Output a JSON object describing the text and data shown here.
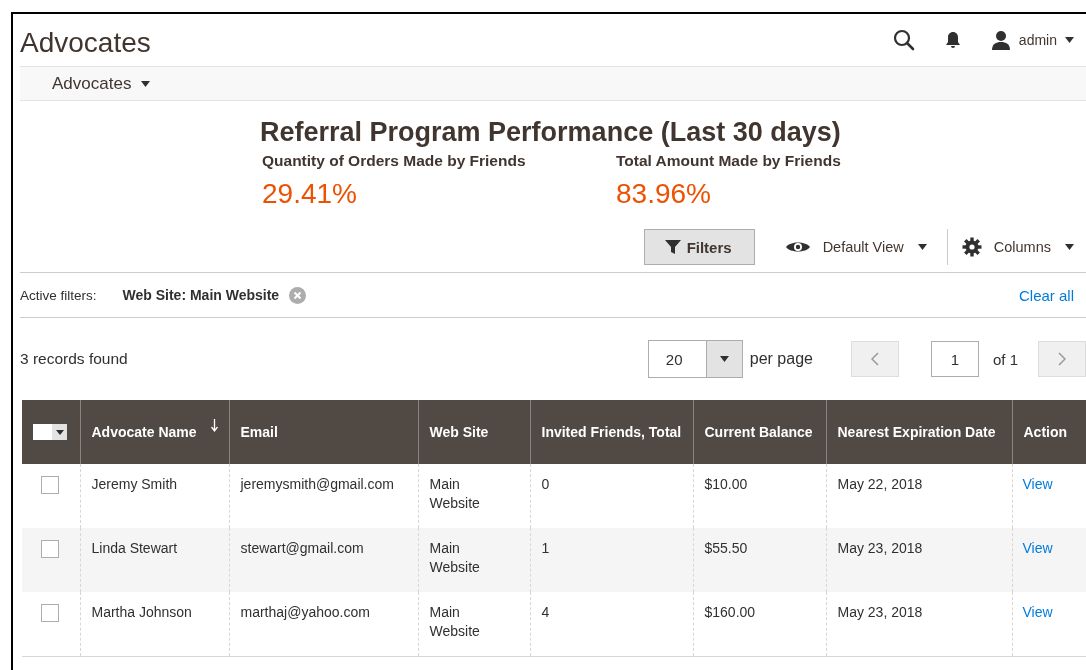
{
  "page": {
    "title": "Advocates",
    "user": "admin"
  },
  "nav": {
    "menu": "Advocates"
  },
  "performance": {
    "title": "Referral Program Performance (Last 30 days)",
    "stats": [
      {
        "label": "Quantity of Orders Made by Friends",
        "value": "29.41%"
      },
      {
        "label": "Total Amount Made by Friends",
        "value": "83.96%"
      }
    ]
  },
  "toolbar": {
    "filters": "Filters",
    "view": "Default View",
    "columns": "Columns"
  },
  "active_filters": {
    "label": "Active filters:",
    "chips": [
      "Web Site: Main Website"
    ],
    "clear": "Clear all"
  },
  "records": "3 records found",
  "pager": {
    "page_size": "20",
    "per_page": "per page",
    "page": "1",
    "of": "of 1"
  },
  "table": {
    "columns": [
      {
        "label": "Advocate Name",
        "sorted": true
      },
      {
        "label": "Email",
        "sorted": false
      },
      {
        "label": "Web Site",
        "sorted": false
      },
      {
        "label": "Invited Friends, Total",
        "sorted": false
      },
      {
        "label": "Current Balance",
        "sorted": false
      },
      {
        "label": "Nearest Expiration Date",
        "sorted": false
      },
      {
        "label": "Action",
        "sorted": false
      }
    ],
    "rows": [
      {
        "checked": false,
        "cells": [
          "Jeremy Smith",
          "jeremysmith@gmail.com",
          "Main Website",
          "0",
          "$10.00",
          "May 22, 2018"
        ],
        "action": "View"
      },
      {
        "checked": false,
        "cells": [
          "Linda Stewart",
          "stewart@gmail.com",
          "Main Website",
          "1",
          "$55.50",
          "May 23, 2018"
        ],
        "action": "View"
      },
      {
        "checked": false,
        "cells": [
          "Martha Johnson",
          "marthaj@yahoo.com",
          "Main Website",
          "4",
          "$160.00",
          "May 23, 2018"
        ],
        "action": "View"
      }
    ]
  }
}
